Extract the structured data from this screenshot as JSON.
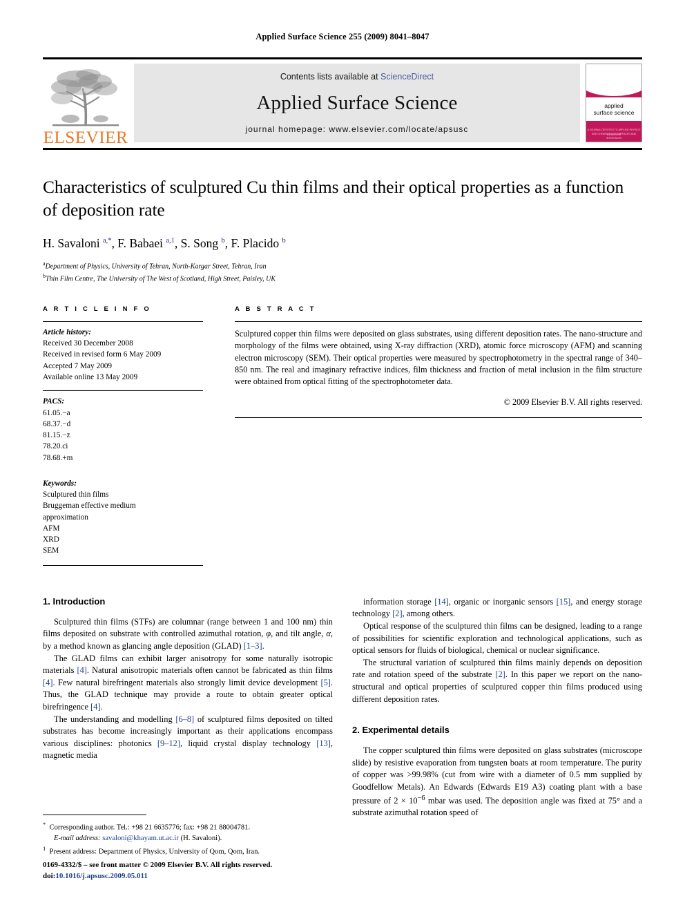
{
  "running_head": "Applied Surface Science 255 (2009) 8041–8047",
  "masthead": {
    "publisher_name": "ELSEVIER",
    "contents_prefix": "Contents lists available at",
    "sciencedirect_label": "ScienceDirect",
    "journal_title": "Applied Surface Science",
    "homepage_line": "journal homepage: www.elsevier.com/locate/apsusc",
    "cover": {
      "line1": "applied",
      "line2": "surface science",
      "subtitle": "A JOURNAL DEVOTED TO APPLIED PHYSICS AND CHEMISTRY OF SURFACES AND INTERFACES",
      "footer": "ELSEVIER"
    },
    "accent_color": "#E87722",
    "cover_color": "#c2185b",
    "link_color": "#4b5a9e"
  },
  "title": "Characteristics of sculptured Cu thin films and their optical properties as a function of deposition rate",
  "authors_html": "H. Savaloni <sup>a,*</sup>, F. Babaei <sup>a,1</sup>, S. Song <sup>b</sup>, F. Placido <sup>b</sup>",
  "affiliations": [
    {
      "marker": "a",
      "text": "Department of Physics, University of Tehran, North-Kargar Street, Tehran, Iran"
    },
    {
      "marker": "b",
      "text": "Thin Film Centre, The University of The West of Scotland, High Street, Paisley, UK"
    }
  ],
  "article_info": {
    "label": "A R T I C L E  I N F O",
    "history_title": "Article history:",
    "history": [
      "Received 30 December 2008",
      "Received in revised form 6 May 2009",
      "Accepted 7 May 2009",
      "Available online 13 May 2009"
    ],
    "pacs_title": "PACS:",
    "pacs": [
      "61.05.−a",
      "68.37.−d",
      "81.15.−z",
      "78.20.ci",
      "78.68.+m"
    ],
    "keywords_title": "Keywords:",
    "keywords": [
      "Sculptured thin films",
      "Bruggeman effective medium",
      "approximation",
      "AFM",
      "XRD",
      "SEM"
    ]
  },
  "abstract": {
    "label": "A B S T R A C T",
    "text": "Sculptured copper thin films were deposited on glass substrates, using different deposition rates. The nano-structure and morphology of the films were obtained, using X-ray diffraction (XRD), atomic force microscopy (AFM) and scanning electron microscopy (SEM). Their optical properties were measured by spectrophotometry in the spectral range of 340–850 nm. The real and imaginary refractive indices, film thickness and fraction of metal inclusion in the film structure were obtained from optical fitting of the spectrophotometer data.",
    "copyright": "© 2009 Elsevier B.V. All rights reserved."
  },
  "body": {
    "section1_heading": "1. Introduction",
    "section2_heading": "2. Experimental details",
    "left_paragraphs_html": [
      "Sculptured thin films (STFs) are columnar (range between 1 and 100 nm) thin films deposited on substrate with controlled azimuthal rotation, <i>&phi;</i>, and tilt angle, <i>&alpha;</i>, by a method known as glancing angle deposition (GLAD) <span class=\"ref\">[1–3]</span>.",
      "The GLAD films can exhibit larger anisotropy for some naturally isotropic materials <span class=\"ref\">[4]</span>. Natural anisotropic materials often cannot be fabricated as thin films <span class=\"ref\">[4]</span>. Few natural birefringent materials also strongly limit device development <span class=\"ref\">[5]</span>. Thus, the GLAD technique may provide a route to obtain greater optical birefringence <span class=\"ref\">[4]</span>.",
      "The understanding and modelling <span class=\"ref\">[6–8]</span> of sculptured films deposited on tilted substrates has become increasingly important as their applications encompass various disciplines: photonics <span class=\"ref\">[9–12]</span>, liquid crystal display technology <span class=\"ref\">[13]</span>, magnetic media"
    ],
    "right_paragraphs_html": [
      "information storage <span class=\"ref\">[14]</span>, organic or inorganic sensors <span class=\"ref\">[15]</span>, and energy storage technology <span class=\"ref\">[2]</span>, among others.",
      "Optical response of the sculptured thin films can be designed, leading to a range of possibilities for scientific exploration and technological applications, such as optical sensors for fluids of biological, chemical or nuclear significance.",
      "The structural variation of sculptured thin films mainly depends on deposition rate and rotation speed of the substrate <span class=\"ref\">[2]</span>. In this paper we report on the nano-structural and optical properties of sculptured copper thin films produced using different deposition rates."
    ],
    "section2_paragraph_html": "The copper sculptured thin films were deposited on glass substrates (microscope slide) by resistive evaporation from tungsten boats at room temperature. The purity of copper was &gt;99.98% (cut from wire with a diameter of 0.5 mm supplied by Goodfellow Metals). An Edwards (Edwards E19 A3) coating plant with a base pressure of 2 &times; 10<sup>−6</sup> mbar was used. The deposition angle was fixed at 75&deg; and a substrate azimuthal rotation speed of"
  },
  "footnotes": {
    "corresponding_html": "<sup>*</sup>&nbsp; Corresponding author. Tel.: +98 21 6635776; fax: +98 21 88004781.",
    "email_html": "<span class=\"it\">E-mail address:</span> <span class=\"mail\">savaloni@khayam.ut.ac.ir</span> (H. Savaloni).",
    "present_address_html": "<sup>1</sup>&nbsp; Present address: Department of Physics, University of Qom, Qom, Iran."
  },
  "footer": {
    "issn_line": "0169-4332/$ – see front matter © 2009 Elsevier B.V. All rights reserved.",
    "doi_prefix": "doi:",
    "doi_value": "10.1016/j.apsusc.2009.05.011"
  }
}
